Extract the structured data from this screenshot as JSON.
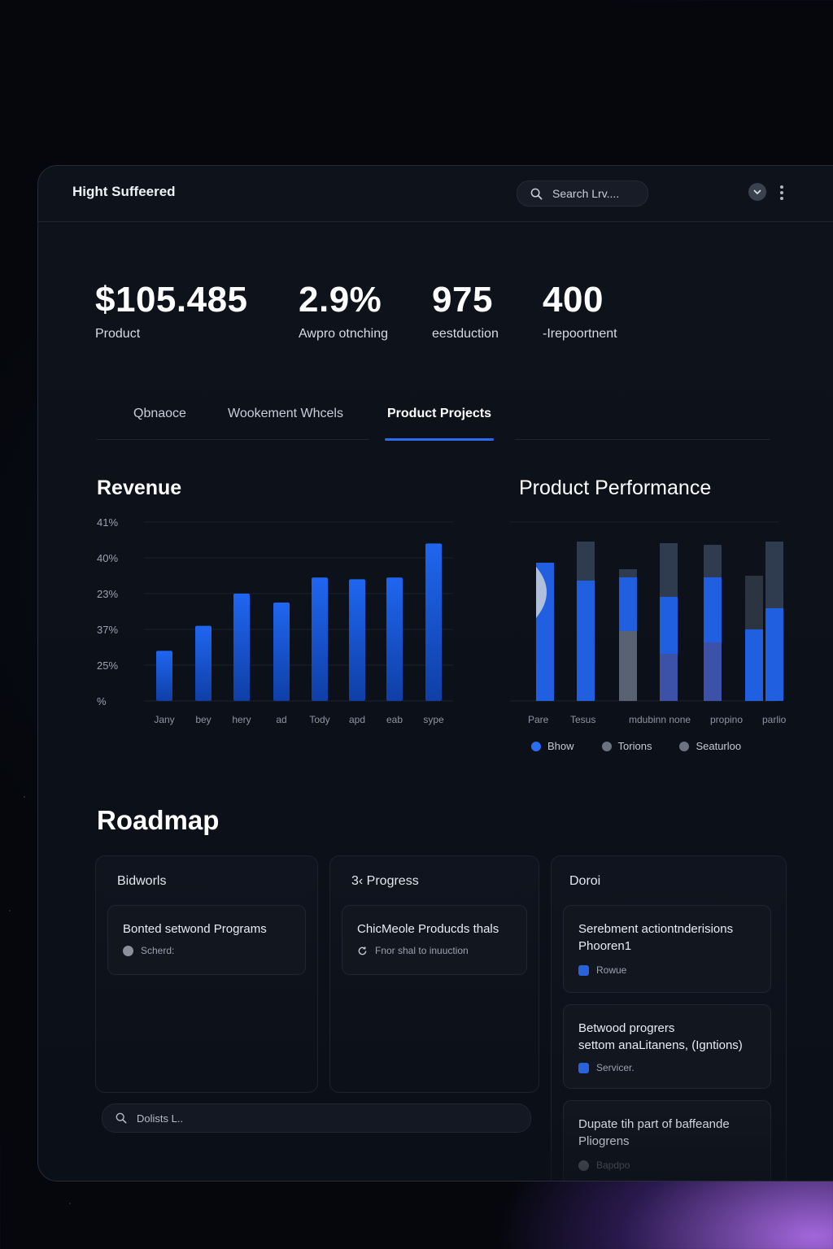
{
  "header": {
    "title": "Hight Suffeered",
    "search_placeholder": "Search Lrv...."
  },
  "kpis": [
    {
      "value": "$105.485",
      "label": "Product"
    },
    {
      "value": "2.9%",
      "label": "Awpro otnching"
    },
    {
      "value": "975",
      "label": "eestduction"
    },
    {
      "value": "400",
      "label": "-Irepoortnent"
    }
  ],
  "tabs": [
    {
      "label": "Qbnaoce",
      "active": false
    },
    {
      "label": "Wookement Whcels",
      "active": false
    },
    {
      "label": "Product Projects",
      "active": true
    }
  ],
  "revenue": {
    "title": "Revenue"
  },
  "performance": {
    "title": "Product Performance"
  },
  "colors": {
    "accent": "#1f5fe0",
    "accent_light": "#2a6df0",
    "bar_dark": "#2f3b4f"
  },
  "chart_data": [
    {
      "type": "bar",
      "title": "Revenue",
      "categories": [
        "Jany",
        "bey",
        "hery",
        "ad",
        "Tody",
        "apd",
        "eab",
        "sype"
      ],
      "values": [
        14,
        21,
        30,
        27.5,
        34.5,
        34,
        34.5,
        44
      ],
      "yticks": [
        "%",
        "25%",
        "37%",
        "23%",
        "40%",
        "41%"
      ],
      "ylim": [
        0,
        50
      ],
      "grid": true
    },
    {
      "type": "bar",
      "title": "Product Performance",
      "stacked": true,
      "categories": [
        "Pare",
        "Tesus",
        "mdubinn none",
        "propino",
        "parlior"
      ],
      "legend": [
        "Bhow",
        "Torions",
        "Seaturloo"
      ],
      "legend_placement": "bottom"
    }
  ],
  "roadmap": {
    "title": "Roadmap",
    "columns": [
      {
        "title": "Bidworls",
        "cards": [
          {
            "title": "Bonted setwond Programs",
            "meta": "Scherd:"
          }
        ]
      },
      {
        "title": "3‹ Progress",
        "cards": [
          {
            "title": "ChicMeole Producds thals",
            "meta": "Fnor shal to inuuction"
          }
        ]
      },
      {
        "title": "Doroi",
        "cards": [
          {
            "title_l1": "Serebment actiontnderisions",
            "title_l2": "Phooren1",
            "meta": "Rowue"
          },
          {
            "title_l1": "Betwood progrers",
            "title_l2": "settom anaLitanens, (Igntions)",
            "meta": "Servicer."
          },
          {
            "title_l1": "Dupate tih part of baffeande",
            "title_l2": "Pliogrens",
            "meta": "Bapdpo"
          }
        ]
      }
    ],
    "search_placeholder": "Dolists L.."
  }
}
